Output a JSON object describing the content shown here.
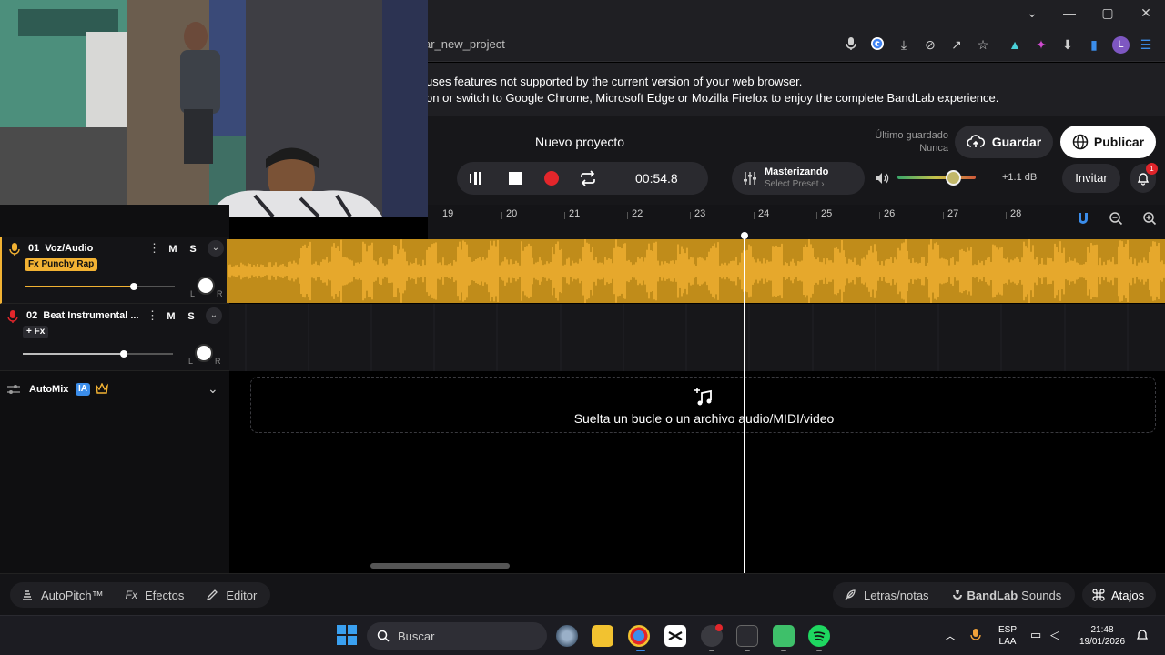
{
  "browser": {
    "url": "ar_new_project",
    "window_controls": [
      "chevron-down",
      "minimize",
      "maximize",
      "close"
    ],
    "extensions": [
      "mic-icon",
      "google-icon",
      "install-icon",
      "eye-off-icon",
      "share-icon",
      "bookmark-icon",
      "beaker-icon",
      "puzzle-icon",
      "download-icon",
      "sidebar-icon",
      "profile",
      "menu-icon"
    ],
    "profile_initial": "L"
  },
  "banner": {
    "line1": "uses features not supported by the current version of your web browser.",
    "line2": "on or switch to Google Chrome, Microsoft Edge or Mozilla Firefox to enjoy the complete BandLab experience."
  },
  "header": {
    "project_title": "Nuevo proyecto",
    "last_saved_label": "Último guardado",
    "last_saved_value": "Nunca",
    "save_label": "Guardar",
    "publish_label": "Publicar",
    "time": "00:54.8",
    "mastering_label": "Masterizando",
    "mastering_preset": "Select Preset ›",
    "master_db": "+1.1 dB",
    "master_level": 0.72,
    "invite_label": "Invitar",
    "notification_count": "1"
  },
  "ruler": {
    "bars": [
      "19",
      "20",
      "21",
      "22",
      "23",
      "24",
      "25",
      "26",
      "27",
      "28"
    ]
  },
  "tracks": [
    {
      "number": "01",
      "name": "Voz/Audio",
      "fx": "Fx Punchy Rap",
      "mute": "M",
      "solo": "S",
      "volume_level": 0.73,
      "pan_left": "L",
      "pan_right": "R"
    },
    {
      "number": "02",
      "name": "Beat Instrumental ...",
      "fx": "+ Fx",
      "mute": "M",
      "solo": "S",
      "volume_level": 0.67,
      "pan_left": "L",
      "pan_right": "R"
    }
  ],
  "automix": {
    "label": "AutoMix",
    "badge": "IA"
  },
  "drop_zone": {
    "text": "Suelta un bucle o un archivo audio/MIDI/video"
  },
  "bottom_bar": {
    "autopitch": "AutoPitch™",
    "effects": "Efectos",
    "effects_prefix": "Fx",
    "editor": "Editor",
    "lyrics": "Letras/notas",
    "sounds_brand": "BandLab",
    "sounds_label": "Sounds",
    "shortcuts": "Atajos"
  },
  "taskbar": {
    "search_placeholder": "Buscar",
    "lang_top": "ESP",
    "lang_bottom": "LAA",
    "time": "21:48",
    "date": "19/01/2026"
  },
  "colors": {
    "audio_track": "#c08c1a",
    "waveform": "#f2b233",
    "record": "#e3262b",
    "accent_blue": "#3b8dea"
  }
}
